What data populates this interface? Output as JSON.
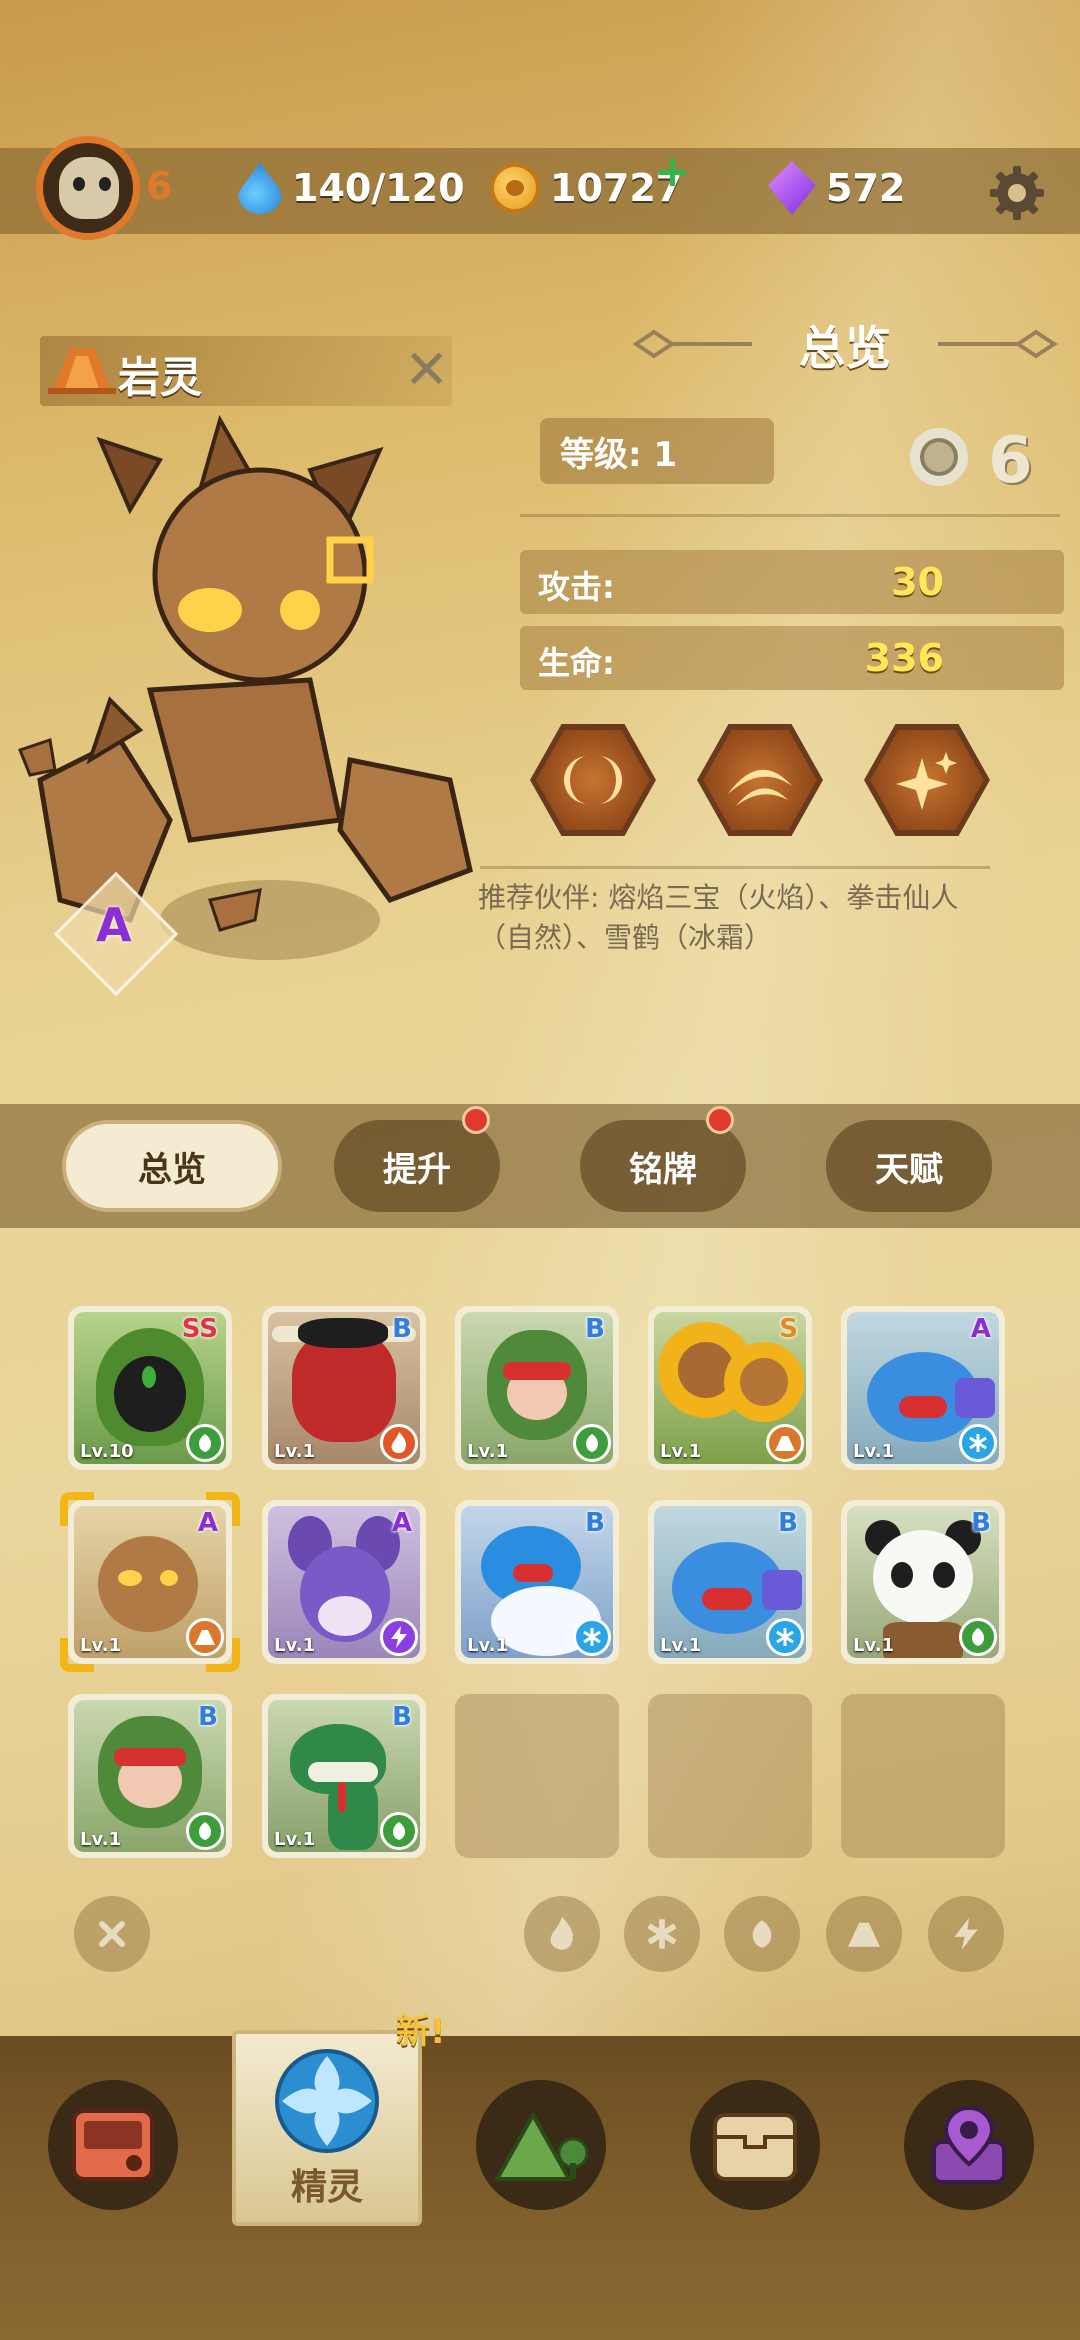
{
  "player": {
    "level": "6"
  },
  "resources": {
    "energy": "140/120",
    "coins": "10727",
    "gems": "572"
  },
  "hero": {
    "name": "岩灵",
    "rank": "A"
  },
  "overview": {
    "title": "总览",
    "level_label": "等级: 1",
    "attack_label": "攻击:",
    "attack_value": "30",
    "hp_label": "生命:",
    "hp_value": "336",
    "partners": "推荐伙伴: 熔焰三宝（火焰）、拳击仙人（自然）、雪鹤（冰霜）"
  },
  "tabs": [
    {
      "label": "总览",
      "active": true,
      "dot": false
    },
    {
      "label": "提升",
      "active": false,
      "dot": true
    },
    {
      "label": "铭牌",
      "active": false,
      "dot": true
    },
    {
      "label": "天赋",
      "active": false,
      "dot": false
    }
  ],
  "creatures": [
    {
      "level": "Lv.10",
      "rank": "SS",
      "rank_color": "#e0334a",
      "element": "nature"
    },
    {
      "level": "Lv.1",
      "rank": "B",
      "rank_color": "#2f7ee0",
      "element": "fire"
    },
    {
      "level": "Lv.1",
      "rank": "B",
      "rank_color": "#2f7ee0",
      "element": "nature"
    },
    {
      "level": "Lv.1",
      "rank": "S",
      "rank_color": "#e78a1c",
      "element": "earth"
    },
    {
      "level": "Lv.1",
      "rank": "A",
      "rank_color": "#8a2fd4",
      "element": "ice"
    },
    {
      "level": "Lv.1",
      "rank": "A",
      "rank_color": "#8a2fd4",
      "element": "earth"
    },
    {
      "level": "Lv.1",
      "rank": "A",
      "rank_color": "#8a2fd4",
      "element": "lightning"
    },
    {
      "level": "Lv.1",
      "rank": "B",
      "rank_color": "#2f7ee0",
      "element": "ice"
    },
    {
      "level": "Lv.1",
      "rank": "B",
      "rank_color": "#2f7ee0",
      "element": "ice"
    },
    {
      "level": "Lv.1",
      "rank": "B",
      "rank_color": "#2f7ee0",
      "element": "nature"
    },
    {
      "level": "Lv.1",
      "rank": "B",
      "rank_color": "#2f7ee0",
      "element": "nature"
    },
    {
      "level": "Lv.1",
      "rank": "B",
      "rank_color": "#2f7ee0",
      "element": "nature"
    }
  ],
  "nav": {
    "active_label": "精灵",
    "new_badge": "新!"
  },
  "colors": {
    "fire": "#e2562a",
    "nature": "#3c9e3a",
    "ice": "#2aa6e6",
    "earth": "#d9782c",
    "lightning": "#8a3fe0"
  }
}
